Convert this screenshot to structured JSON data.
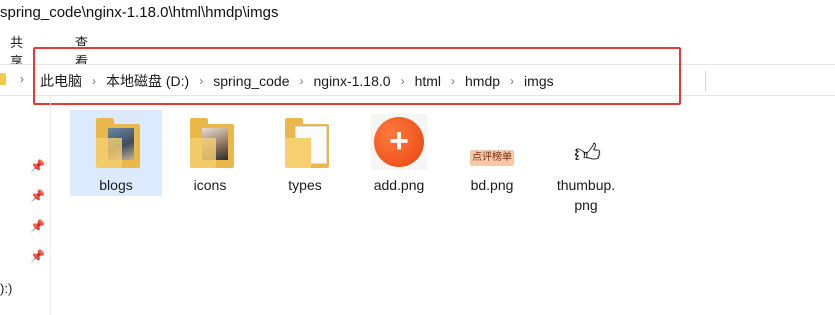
{
  "window": {
    "path_title": "spring_code\\nginx-1.18.0\\html\\hmdp\\imgs"
  },
  "ribbon": {
    "share": "共享",
    "view": "查看"
  },
  "address_bar": {
    "crumbs": [
      "此电脑",
      "本地磁盘 (D:)",
      "spring_code",
      "nginx-1.18.0",
      "html",
      "hmdp",
      "imgs"
    ]
  },
  "nav_pane": {
    "drive_label": "):)"
  },
  "files": [
    {
      "name": "blogs",
      "type": "folder",
      "selected": true
    },
    {
      "name": "icons",
      "type": "folder"
    },
    {
      "name": "types",
      "type": "folder"
    },
    {
      "name": "add.png",
      "type": "image"
    },
    {
      "name": "bd.png",
      "type": "image",
      "icon_text": "点评榜单"
    },
    {
      "name_line1": "thumbup.",
      "name_line2": "png",
      "type": "image",
      "icon": "thumbs-up-icon"
    }
  ],
  "colors": {
    "highlight_border": "#e53935",
    "selection": "#dbeafe",
    "folder": "#eab84a",
    "add_icon": "#e74510"
  }
}
